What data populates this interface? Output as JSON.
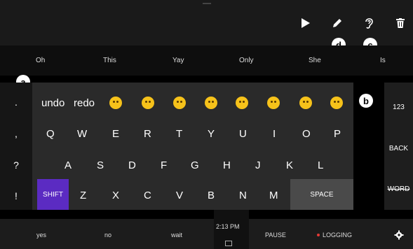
{
  "toolbar": {
    "play_icon": "▶",
    "edit_icon": "✎",
    "listen_icon": "ear-icon",
    "delete_icon": "trash-icon"
  },
  "predictions": [
    "Oh",
    "This",
    "Yay",
    "Only",
    "She",
    "Is"
  ],
  "badges": {
    "a": "a",
    "b": "b",
    "c": "c",
    "d": "d"
  },
  "left_column": [
    ".",
    ",",
    "?",
    "!"
  ],
  "keyboard": {
    "undo": "undo",
    "redo": "redo",
    "row_q": [
      "Q",
      "W",
      "E",
      "R",
      "T",
      "Y",
      "U",
      "I",
      "O",
      "P"
    ],
    "row_a": [
      "A",
      "S",
      "D",
      "F",
      "G",
      "H",
      "J",
      "K",
      "L"
    ],
    "shift": "SHIFT",
    "row_z": [
      "Z",
      "X",
      "C",
      "V",
      "B",
      "N",
      "M"
    ],
    "space": "SPACE"
  },
  "right_panel": {
    "num": "123",
    "back": "BACK",
    "word": "WORD"
  },
  "bottom": {
    "yes": "yes",
    "no": "no",
    "wait": "wait",
    "time": "2:13 PM",
    "pause": "PAUSE",
    "logging": "LOGGING",
    "logging_color": "#e53935",
    "settings_icon": "gear-icon"
  },
  "colors": {
    "shift": "#5b2bc2",
    "space": "#4a4a4a",
    "emoji": "#f6c21a"
  }
}
